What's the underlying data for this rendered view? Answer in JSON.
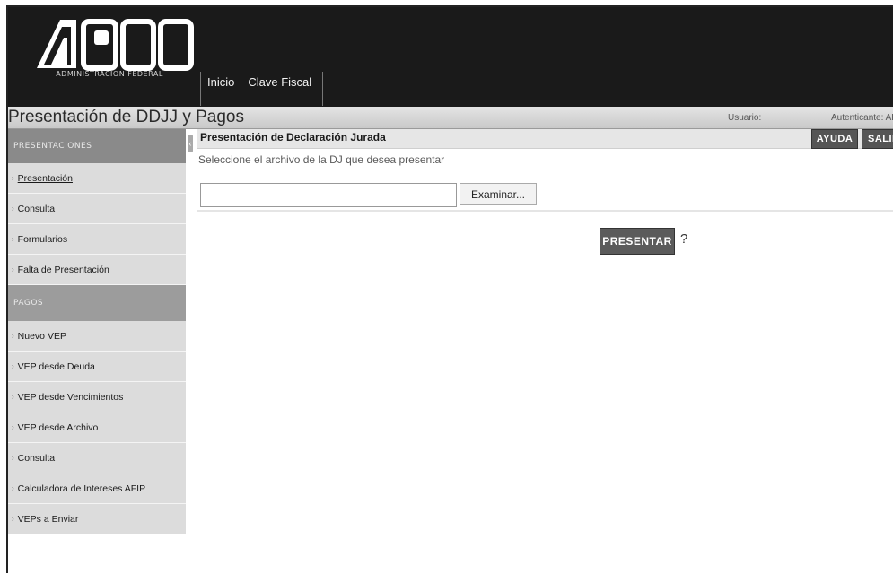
{
  "header": {
    "logo_text": "AFIP",
    "logo_subtitle": "ADMINISTRACION FEDERAL",
    "nav": [
      "Inicio",
      "Clave Fiscal"
    ]
  },
  "titlebar": {
    "title": "Presentación de DDJJ y Pagos",
    "user_label": "Usuario:",
    "auth_label": "Autenticante: AF"
  },
  "sidebar": {
    "presentaciones_header": "PRESENTACIONES",
    "presentaciones_items": [
      "Presentación",
      "Consulta",
      "Formularios",
      "Falta de Presentación"
    ],
    "pagos_header": "PAGOS",
    "pagos_items": [
      "Nuevo VEP",
      "VEP desde Deuda",
      "VEP desde Vencimientos",
      "VEP desde Archivo",
      "Consulta",
      "Calculadora de Intereses AFIP",
      "VEPs a Enviar"
    ]
  },
  "content": {
    "title": "Presentación de Declaración Jurada",
    "help_button": "AYUDA",
    "exit_button": "SALIR",
    "instruction": "Seleccione el archivo de la DJ que desea presentar",
    "file_value": "",
    "browse_button": "Examinar...",
    "submit_button": "PRESENTAR",
    "help_mark": "?"
  }
}
